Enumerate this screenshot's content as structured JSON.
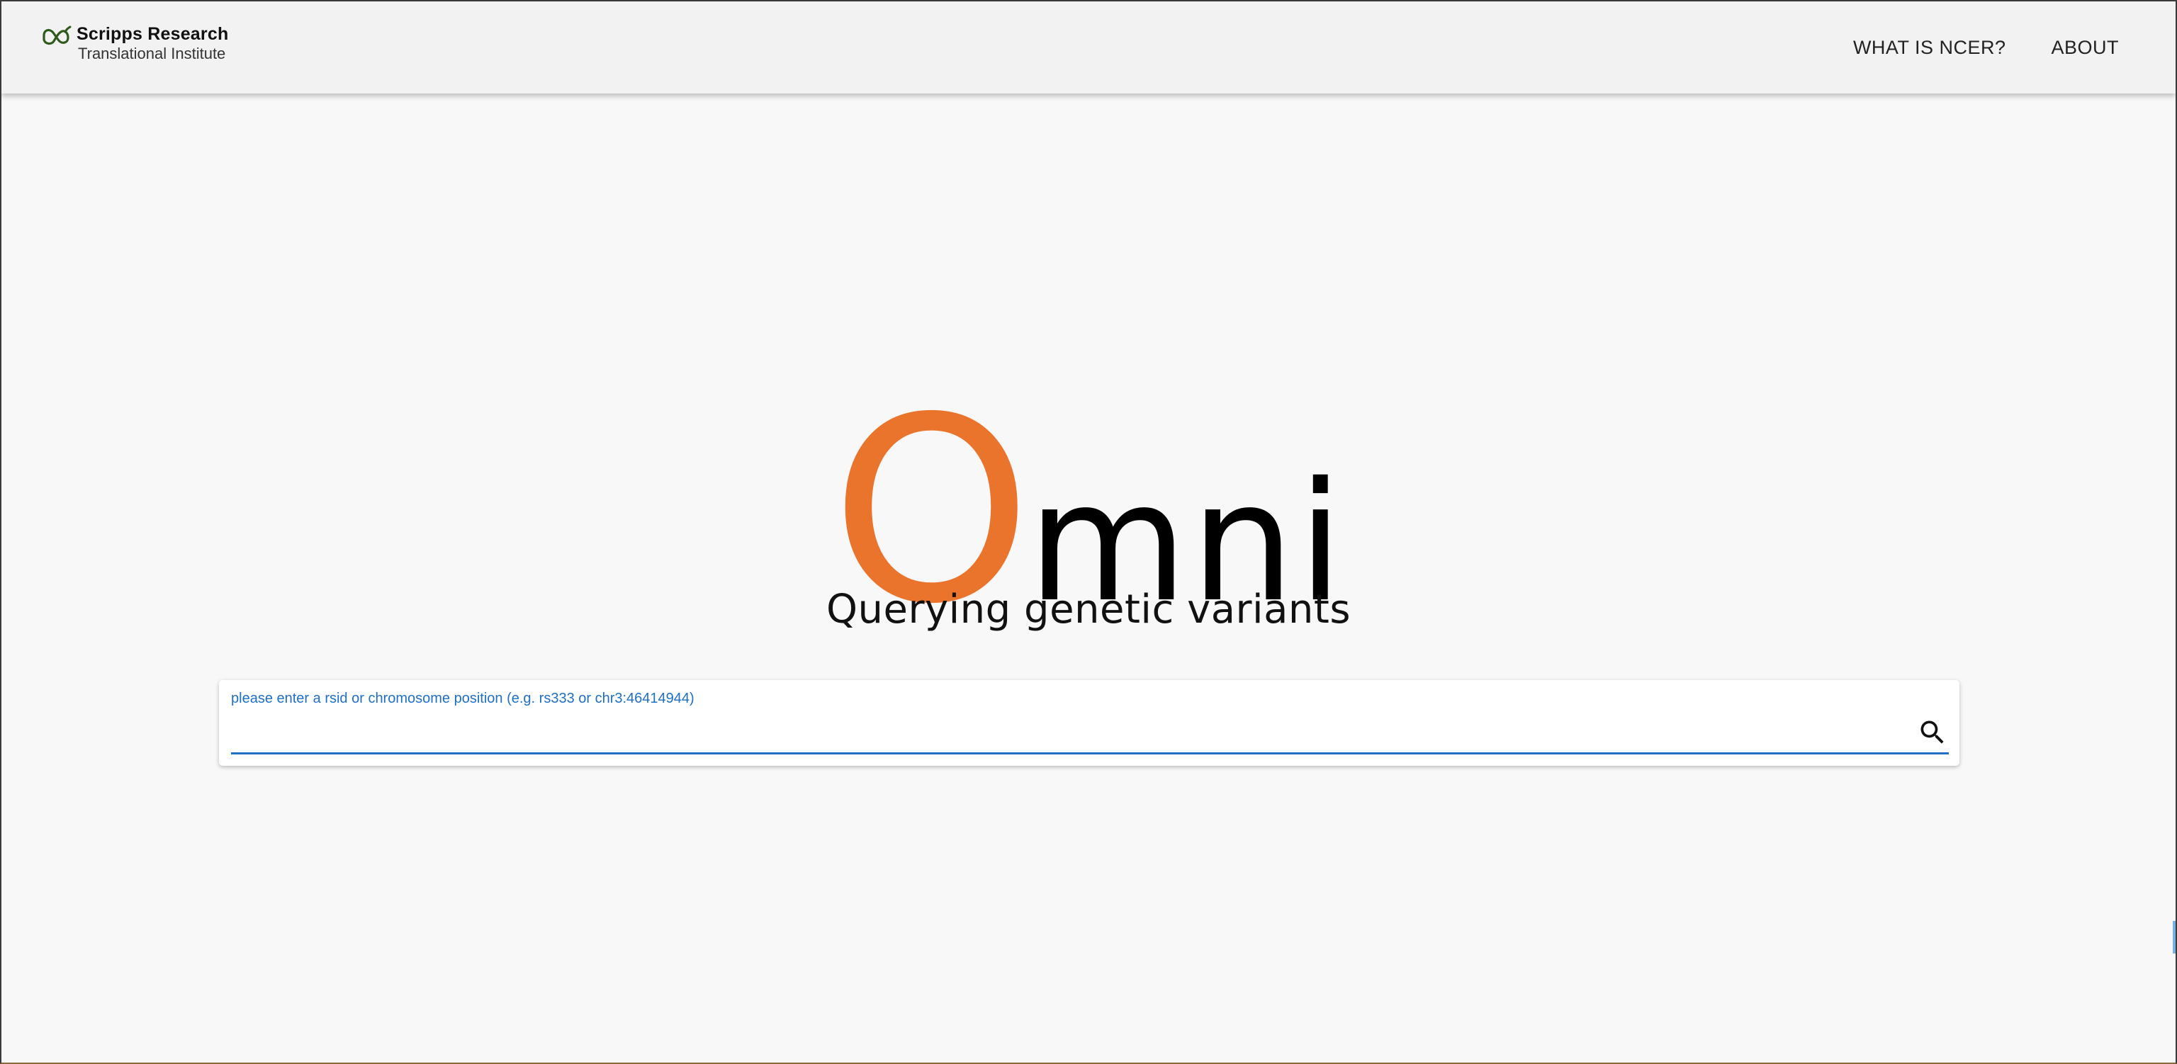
{
  "header": {
    "brand_name": "Scripps Research",
    "brand_sub": "Translational Institute",
    "nav": [
      {
        "label": "WHAT IS NCER?"
      },
      {
        "label": "ABOUT"
      }
    ]
  },
  "hero": {
    "logo_first": "O",
    "logo_rest": "mni",
    "tagline": "Querying genetic variants"
  },
  "search": {
    "label": "please enter a rsid or chromosome position (e.g. rs333 or chr3:46414944)",
    "value": "",
    "placeholder": ""
  },
  "colors": {
    "accent_orange": "#ea742c",
    "link_blue": "#1f6fc4",
    "brand_green": "#2e5a1c"
  }
}
